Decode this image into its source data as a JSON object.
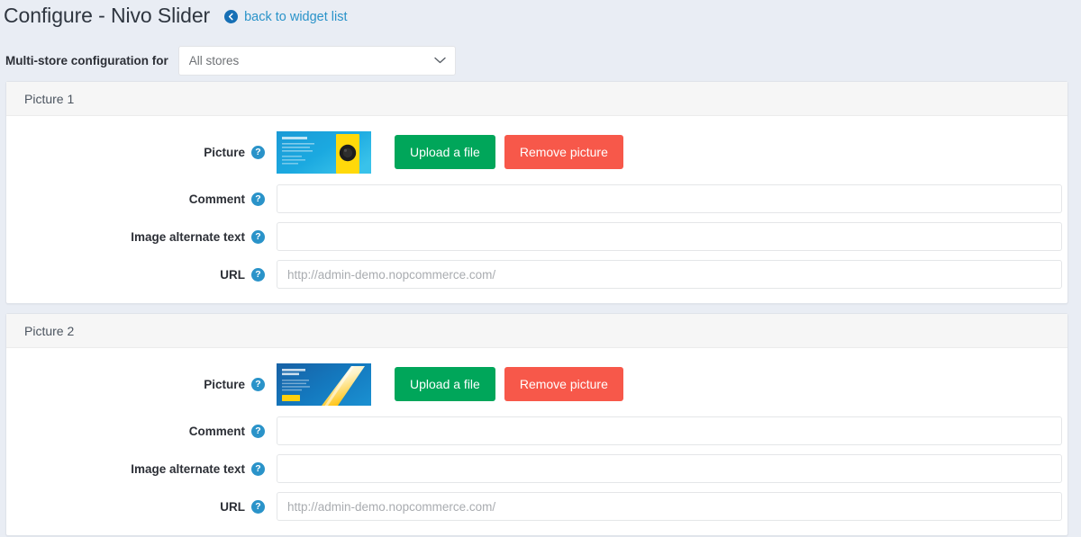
{
  "header": {
    "title": "Configure - Nivo Slider",
    "back_link_label": "back to widget list",
    "back_icon": "arrow-circle-left-icon"
  },
  "store_config": {
    "label": "Multi-store configuration for",
    "selected": "All stores",
    "options": [
      "All stores"
    ],
    "caret_icon": "chevron-down-icon"
  },
  "colors": {
    "page_background": "#e9edf4",
    "panel_background": "#ffffff",
    "panel_header": "#f6f6f6",
    "link": "#2a93c9",
    "help_icon": "#2a93c9",
    "upload_button": "#00a65a",
    "remove_button": "#f7584a",
    "back_icon": "#166fb5"
  },
  "labels": {
    "picture": "Picture",
    "comment": "Comment",
    "alt_text": "Image alternate text",
    "url": "URL",
    "help_glyph": "?",
    "upload_button": "Upload a file",
    "remove_button": "Remove picture",
    "url_placeholder": "http://admin-demo.nopcommerce.com/",
    "empty_value": ""
  },
  "panels": [
    {
      "title": "Picture 1",
      "thumbnail_name": "nivo-slider-picture-1-thumbnail",
      "picture_label": "Picture",
      "upload_button": "Upload a file",
      "remove_button": "Remove picture",
      "comment_label": "Comment",
      "comment_value": "",
      "alt_label": "Image alternate text",
      "alt_value": "",
      "url_label": "URL",
      "url_value": "",
      "url_placeholder": "http://admin-demo.nopcommerce.com/"
    },
    {
      "title": "Picture 2",
      "thumbnail_name": "nivo-slider-picture-2-thumbnail",
      "picture_label": "Picture",
      "upload_button": "Upload a file",
      "remove_button": "Remove picture",
      "comment_label": "Comment",
      "comment_value": "",
      "alt_label": "Image alternate text",
      "alt_value": "",
      "url_label": "URL",
      "url_value": "",
      "url_placeholder": "http://admin-demo.nopcommerce.com/"
    }
  ]
}
